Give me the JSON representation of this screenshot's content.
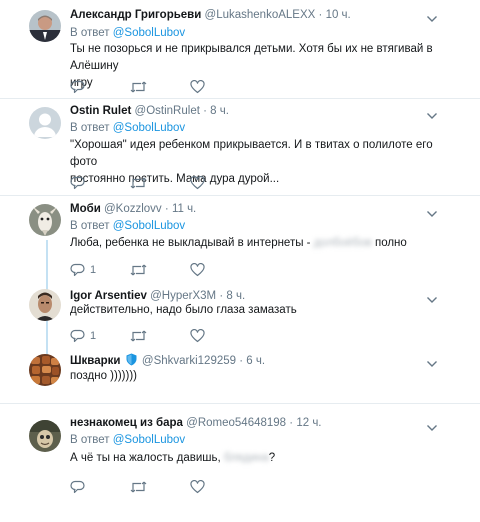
{
  "tweets": [
    {
      "name": "Александр Григорьеви",
      "handle": "@LukashenkoALEXX",
      "sep": "·",
      "time": "10 ч.",
      "reply_prefix": "В ответ",
      "reply_to": "@SobolLubov",
      "text_lines": [
        "Ты не позорься и не прикрывался детьми. Хотя бы их не втягивай в Алёшину",
        "игру"
      ],
      "reply_count": "",
      "retweet_count": "",
      "like_count": ""
    },
    {
      "name": "Ostin Rulet",
      "handle": "@OstinRulet",
      "sep": "·",
      "time": "8 ч.",
      "reply_prefix": "В ответ",
      "reply_to": "@SobolLubov",
      "text_lines": [
        "\"Хорошая\" идея ребенком прикрывается. И в твитах о полилоте его фото",
        "постоянно постить. Мама дура дурой..."
      ],
      "reply_count": "",
      "retweet_count": "",
      "like_count": ""
    },
    {
      "name": "Моби",
      "handle": "@Kozzlovv",
      "sep": "·",
      "time": "11 ч.",
      "reply_prefix": "В ответ",
      "reply_to": "@SobolLubov",
      "text": "Люба, ребенка не выкладывай в интернеты -",
      "text_hidden": "долбоёбов",
      "text_after": "полно",
      "reply_count": "1",
      "retweet_count": "",
      "like_count": ""
    },
    {
      "name": "Igor Arsentiev",
      "handle": "@HyperX3M",
      "sep": "·",
      "time": "8 ч.",
      "text": "действительно, надо было глаза замазать",
      "reply_count": "1",
      "retweet_count": "",
      "like_count": ""
    },
    {
      "name": "Шкварки",
      "handle": "@Shkvarki129259",
      "sep": "·",
      "time": "6 ч.",
      "text": "поздно )))))))",
      "reply_count": "",
      "retweet_count": "",
      "like_count": ""
    },
    {
      "name": "незнакомец из бара",
      "handle": "@Romeo54648198",
      "sep": "·",
      "time": "12 ч.",
      "reply_prefix": "В ответ",
      "reply_to": "@SobolLubov",
      "text": "А чё ты на жалость давишь,",
      "text_hidden": "блядина",
      "text_after": "?",
      "reply_count": "",
      "retweet_count": "",
      "like_count": ""
    }
  ],
  "icons": {
    "reply": "reply-icon",
    "retweet": "retweet-icon",
    "like": "heart-icon",
    "more": "chevron-down-icon",
    "badge": "shield-badge-icon"
  },
  "colors": {
    "link": "#1b95e0",
    "secondary": "#657786",
    "thread_line": "#c4e1f3",
    "divider": "#e6ecf0"
  }
}
